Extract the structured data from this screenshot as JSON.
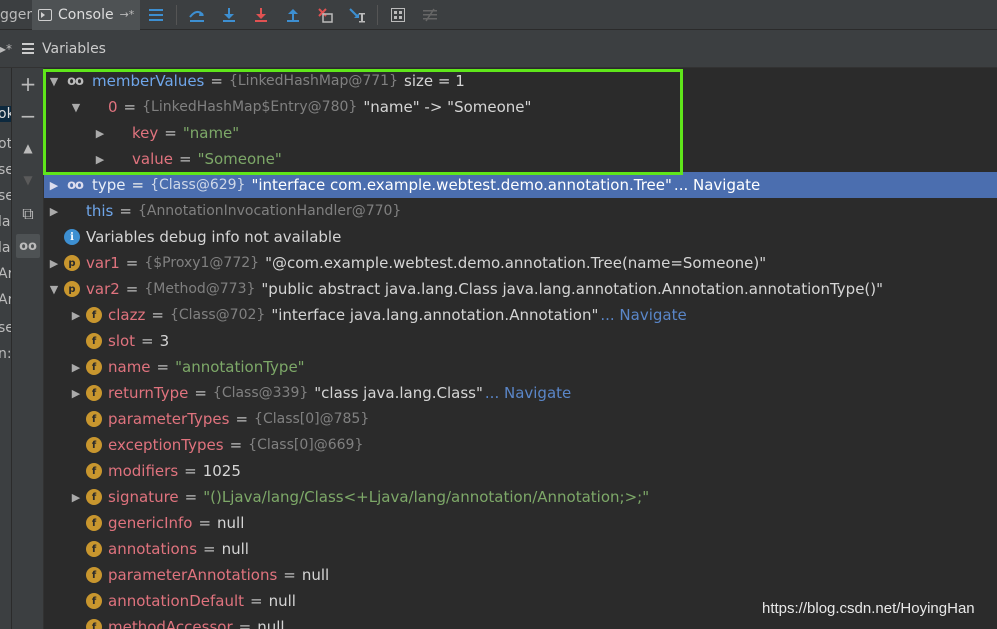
{
  "toolbar": {
    "debugger_tab_label": "gger",
    "console_tab_label": "Console",
    "pin_label": "→*",
    "icons": [
      "restore-layout-icon",
      "step-over-icon",
      "step-into-icon",
      "force-step-into-icon",
      "step-out-icon",
      "drop-frame-icon",
      "run-to-cursor-icon",
      "evaluate-expression-icon",
      "trace-icon"
    ]
  },
  "variables_panel": {
    "title": "Variables",
    "left_stub_glyph": "▸*"
  },
  "left_strip": {
    "items": [
      "ok",
      "ot",
      "se",
      "se",
      "la",
      "la",
      "Ar",
      "Ar",
      "se",
      "n:"
    ]
  },
  "side_buttons": {
    "add_label": "+",
    "remove_label": "−",
    "up_label": "▲",
    "down_label": "▼",
    "copy_label": "⧉",
    "watch_label": "oo"
  },
  "tree": [
    {
      "name": "memberValues",
      "ref": "{LinkedHashMap@771}",
      "text": " size = 1"
    },
    {
      "name": "0",
      "ref": "{LinkedHashMap$Entry@780}",
      "text": "\"name\" -> \"Someone\""
    },
    {
      "name": "key",
      "value": "\"name\""
    },
    {
      "name": "value",
      "value": "\"Someone\""
    },
    {
      "name": "type",
      "ref": "{Class@629}",
      "text": "\"interface com.example.webtest.demo.annotation.Tree\"",
      "nav": "... Navigate"
    },
    {
      "name": "this",
      "ref": "{AnnotationInvocationHandler@770}"
    },
    {
      "text": "Variables debug info not available"
    },
    {
      "name": "var1",
      "ref": "{$Proxy1@772}",
      "text": "\"@com.example.webtest.demo.annotation.Tree(name=Someone)\""
    },
    {
      "name": "var2",
      "ref": "{Method@773}",
      "text": "\"public abstract java.lang.Class java.lang.annotation.Annotation.annotationType()\""
    },
    {
      "name": "clazz",
      "ref": "{Class@702}",
      "text": "\"interface java.lang.annotation.Annotation\"",
      "nav": "... Navigate"
    },
    {
      "name": "slot",
      "value": "3"
    },
    {
      "name": "name",
      "value": "\"annotationType\""
    },
    {
      "name": "returnType",
      "ref": "{Class@339}",
      "text": "\"class java.lang.Class\"",
      "nav": "... Navigate"
    },
    {
      "name": "parameterTypes",
      "ref": "{Class[0]@785}"
    },
    {
      "name": "exceptionTypes",
      "ref": "{Class[0]@669}"
    },
    {
      "name": "modifiers",
      "value": "1025"
    },
    {
      "name": "signature",
      "value": "\"()Ljava/lang/Class<+Ljava/lang/annotation/Annotation;>;\""
    },
    {
      "name": "genericInfo",
      "value": "null"
    },
    {
      "name": "annotations",
      "value": "null"
    },
    {
      "name": "parameterAnnotations",
      "value": "null"
    },
    {
      "name": "annotationDefault",
      "value": "null"
    },
    {
      "name": "methodAccessor",
      "value": "null"
    }
  ],
  "eq": "=",
  "watermark": "https://blog.csdn.net/HoyingHan",
  "colors": {
    "highlight_box": "#5fe61a",
    "selection": "#4b6eaf",
    "field_name": "#e0737e",
    "string_value": "#7da868",
    "navigate_link": "#5a86c8"
  }
}
